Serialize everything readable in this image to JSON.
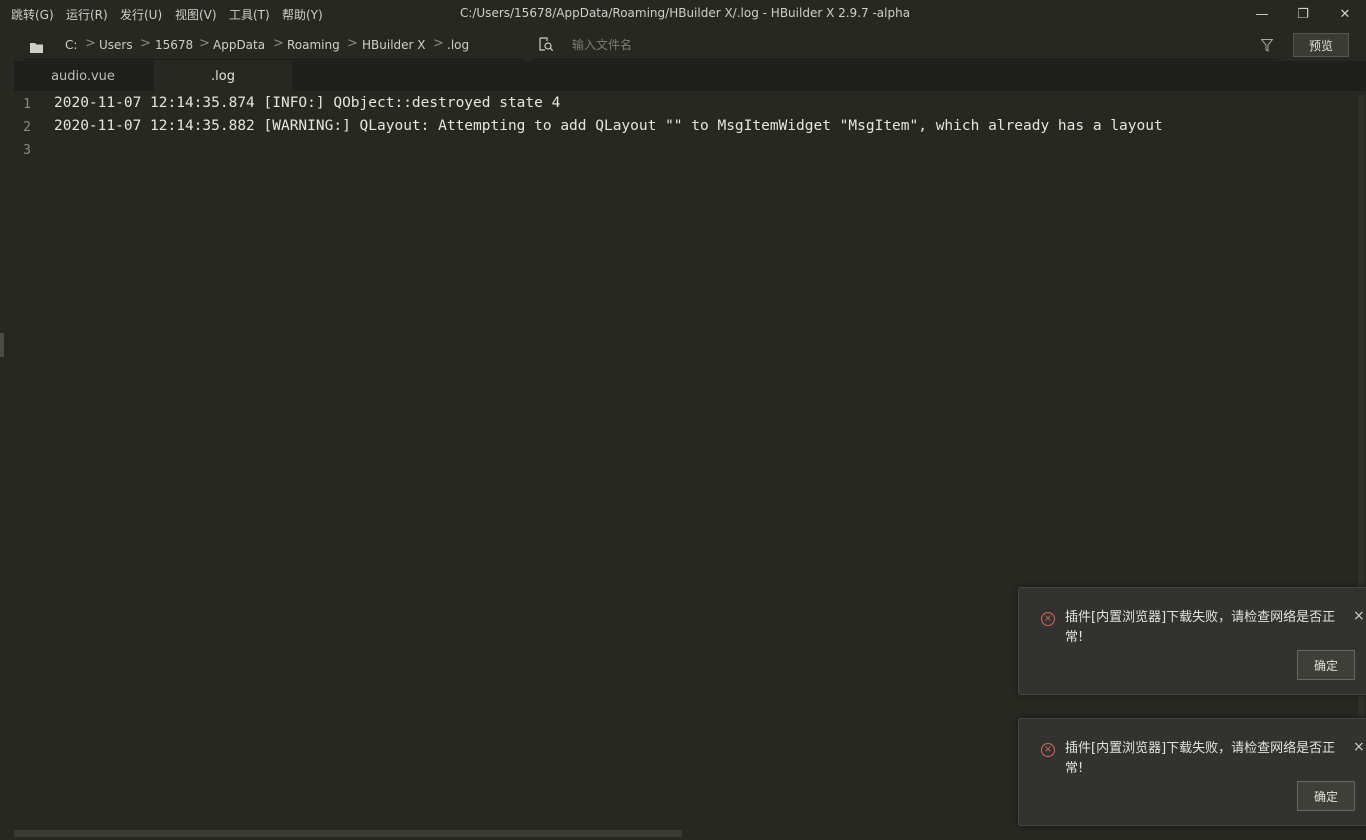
{
  "menu": [
    "跳转(G)",
    "运行(R)",
    "发行(U)",
    "视图(V)",
    "工具(T)",
    "帮助(Y)"
  ],
  "window": {
    "title": "C:/Users/15678/AppData/Roaming/HBuilder X/.log - HBuilder X 2.9.7 -alpha",
    "minimize": "—",
    "maximize": "❐",
    "close": "✕"
  },
  "breadcrumb": [
    "C:",
    "Users",
    "15678",
    "AppData",
    "Roaming",
    "HBuilder X",
    ".log"
  ],
  "breadcrumb_separator": ">",
  "search": {
    "placeholder": "输入文件名",
    "value": ""
  },
  "preview_button": "预览",
  "tabs": [
    {
      "label": "audio.vue",
      "active": false
    },
    {
      "label": ".log",
      "active": true
    }
  ],
  "editor": {
    "lines": [
      {
        "num": "1",
        "text": "2020-11-07 12:14:35.874 [INFO:] QObject::destroyed state 4"
      },
      {
        "num": "2",
        "text": "2020-11-07 12:14:35.882 [WARNING:] QLayout: Attempting to add QLayout \"\" to MsgItemWidget \"MsgItem\", which already has a layout"
      },
      {
        "num": "3",
        "text": ""
      }
    ]
  },
  "notifications": [
    {
      "message": "插件[内置浏览器]下载失败，请检查网络是否正常!",
      "ok": "确定",
      "close": "×",
      "icon": "error-icon"
    },
    {
      "message": "插件[内置浏览器]下载失败，请检查网络是否正常!",
      "ok": "确定",
      "close": "×",
      "icon": "error-icon"
    }
  ],
  "colors": {
    "background": "#272822",
    "tabbar": "#1f201b",
    "error": "#d4685e"
  }
}
